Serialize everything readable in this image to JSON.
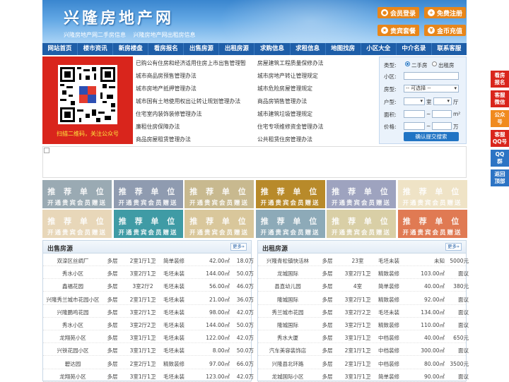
{
  "header": {
    "logo": "兴隆房地产网",
    "slogan1": "兴隆房地产网二手房信息",
    "slogan2": "兴隆房地产网出租房信息",
    "buttons": [
      "会员登录",
      "免费注册",
      "贵宾套餐",
      "金币充值"
    ]
  },
  "nav": [
    "网站首页",
    "楼市资讯",
    "新房楼盘",
    "看房报名",
    "出售房源",
    "出租房源",
    "求购信息",
    "求租信息",
    "地图找房",
    "小区大全",
    "中介名录",
    "联系客服"
  ],
  "qr": {
    "caption": "扫描二维码，关注公众号"
  },
  "links": [
    [
      "已购公有住房和经济适用住房上市出售管理暂",
      "房屋建筑工程质量保修办法"
    ],
    [
      "城市商品房预售管理办法",
      "城市房地产转让管理规定"
    ],
    [
      "城市房地产抵押管理办法",
      "城市危险房屋管理规定"
    ],
    [
      "城市国有土地使用权出让转让规划管理办法",
      "商品房销售管理办法"
    ],
    [
      "住宅室内装饰装修管理办法",
      "城市建筑垃圾管理规定"
    ],
    [
      "廉租住房保障办法",
      "住宅专项维修资金管理办法"
    ],
    [
      "商品房屋租赁管理办法",
      "公共租赁住房管理办法"
    ]
  ],
  "search": {
    "type_label": "类型:",
    "opt1": "二手房",
    "opt2": "出租房",
    "area_label": "小区:",
    "room_label": "房型:",
    "room_select": "-- 可选择 --",
    "unit_label": "户型:",
    "unit_room": "室",
    "unit_hall": "厅",
    "size_label": "面积:",
    "size_unit": "m²",
    "price_label": "价格:",
    "price_unit": "万",
    "submit": "确认提交搜索"
  },
  "recommend": {
    "title": "推 荐 单 位",
    "sub": "开通贵宾会员赠送",
    "colors": [
      "#9aaab3",
      "#8f9bb0",
      "#c8b98f",
      "#b88a2a",
      "#9ea3bf",
      "#efe3c6",
      "#e8d7b9",
      "#3f9ba5",
      "#d9c79b",
      "#8daab8",
      "#d9cfa6",
      "#e07a53"
    ]
  },
  "sale": {
    "title": "出售房源",
    "more": "更多»",
    "rows": [
      [
        "双滦区丝绸厂",
        "多层",
        "2室1厅1卫",
        "简单装修",
        "42.00㎡",
        "18.0万"
      ],
      [
        "秀水小区",
        "多层",
        "3室2厅1卫",
        "毛坯未装",
        "144.00㎡",
        "50.0万"
      ],
      [
        "鑫福花园",
        "多层",
        "3室2厅2",
        "毛坯未装",
        "56.00㎡",
        "46.0万"
      ],
      [
        "兴隆秀兰城市花园小区",
        "多层",
        "2室1厅1卫",
        "毛坯未装",
        "21.00㎡",
        "36.0万"
      ],
      [
        "兴隆鹏鸣花园",
        "多层",
        "3室2厅1卫",
        "毛坯未装",
        "98.00㎡",
        "42.0万"
      ],
      [
        "秀水小区",
        "多层",
        "3室2厅2卫",
        "毛坯未装",
        "144.00㎡",
        "50.0万"
      ],
      [
        "龙翔苑小区",
        "多层",
        "3室1厅1卫",
        "毛坯未装",
        "122.00㎡",
        "42.0万"
      ],
      [
        "兴铁花园小区",
        "多层",
        "3室1厅1卫",
        "毛坯未装",
        "8.00㎡",
        "50.0万"
      ],
      [
        "碧达园",
        "多层",
        "2室2厅1卫",
        "精致装修",
        "97.00㎡",
        "66.0万"
      ],
      [
        "龙翔苑小区",
        "多层",
        "3室1厅1卫",
        "毛坯未装",
        "123.00㎡",
        "42.0万"
      ]
    ]
  },
  "rent": {
    "title": "出租房源",
    "more": "更多»",
    "rows": [
      [
        "兴隆青松镇快活林",
        "多层",
        "23室",
        "毛坯未装",
        "未知",
        "5000元"
      ],
      [
        "龙城国际",
        "多层",
        "3室2厅1卫",
        "精致装修",
        "103.00㎡",
        "面议"
      ],
      [
        "县直幼儿园",
        "多层",
        "4室",
        "简单装修",
        "40.00㎡",
        "380元"
      ],
      [
        "隆城国际",
        "多层",
        "3室2厅1卫",
        "精致装修",
        "92.00㎡",
        "面议"
      ],
      [
        "秀兰城市花园",
        "多层",
        "3室2厅2卫",
        "毛坯未装",
        "134.00㎡",
        "面议"
      ],
      [
        "隆城国际",
        "多层",
        "3室2厅1卫",
        "精致装修",
        "110.00㎡",
        "面议"
      ],
      [
        "秀水大厦",
        "多层",
        "3室1厅1卫",
        "中档装修",
        "40.00㎡",
        "650元"
      ],
      [
        "汽车美容装饰店",
        "多层",
        "2室1厅1卫",
        "中档装修",
        "300.00㎡",
        "面议"
      ],
      [
        "兴隆县北环路",
        "多层",
        "2室1厅1卫",
        "中档装修",
        "80.00㎡",
        "3500元"
      ],
      [
        "龙城国际小区",
        "多层",
        "3室1厅1卫",
        "简单装修",
        "90.00㎡",
        "面议"
      ]
    ]
  },
  "side": [
    "看房\n报名",
    "客服\n微信",
    "公众\n号",
    "客服\nQQ号",
    "QQ\n群",
    "返回\n顶部"
  ]
}
